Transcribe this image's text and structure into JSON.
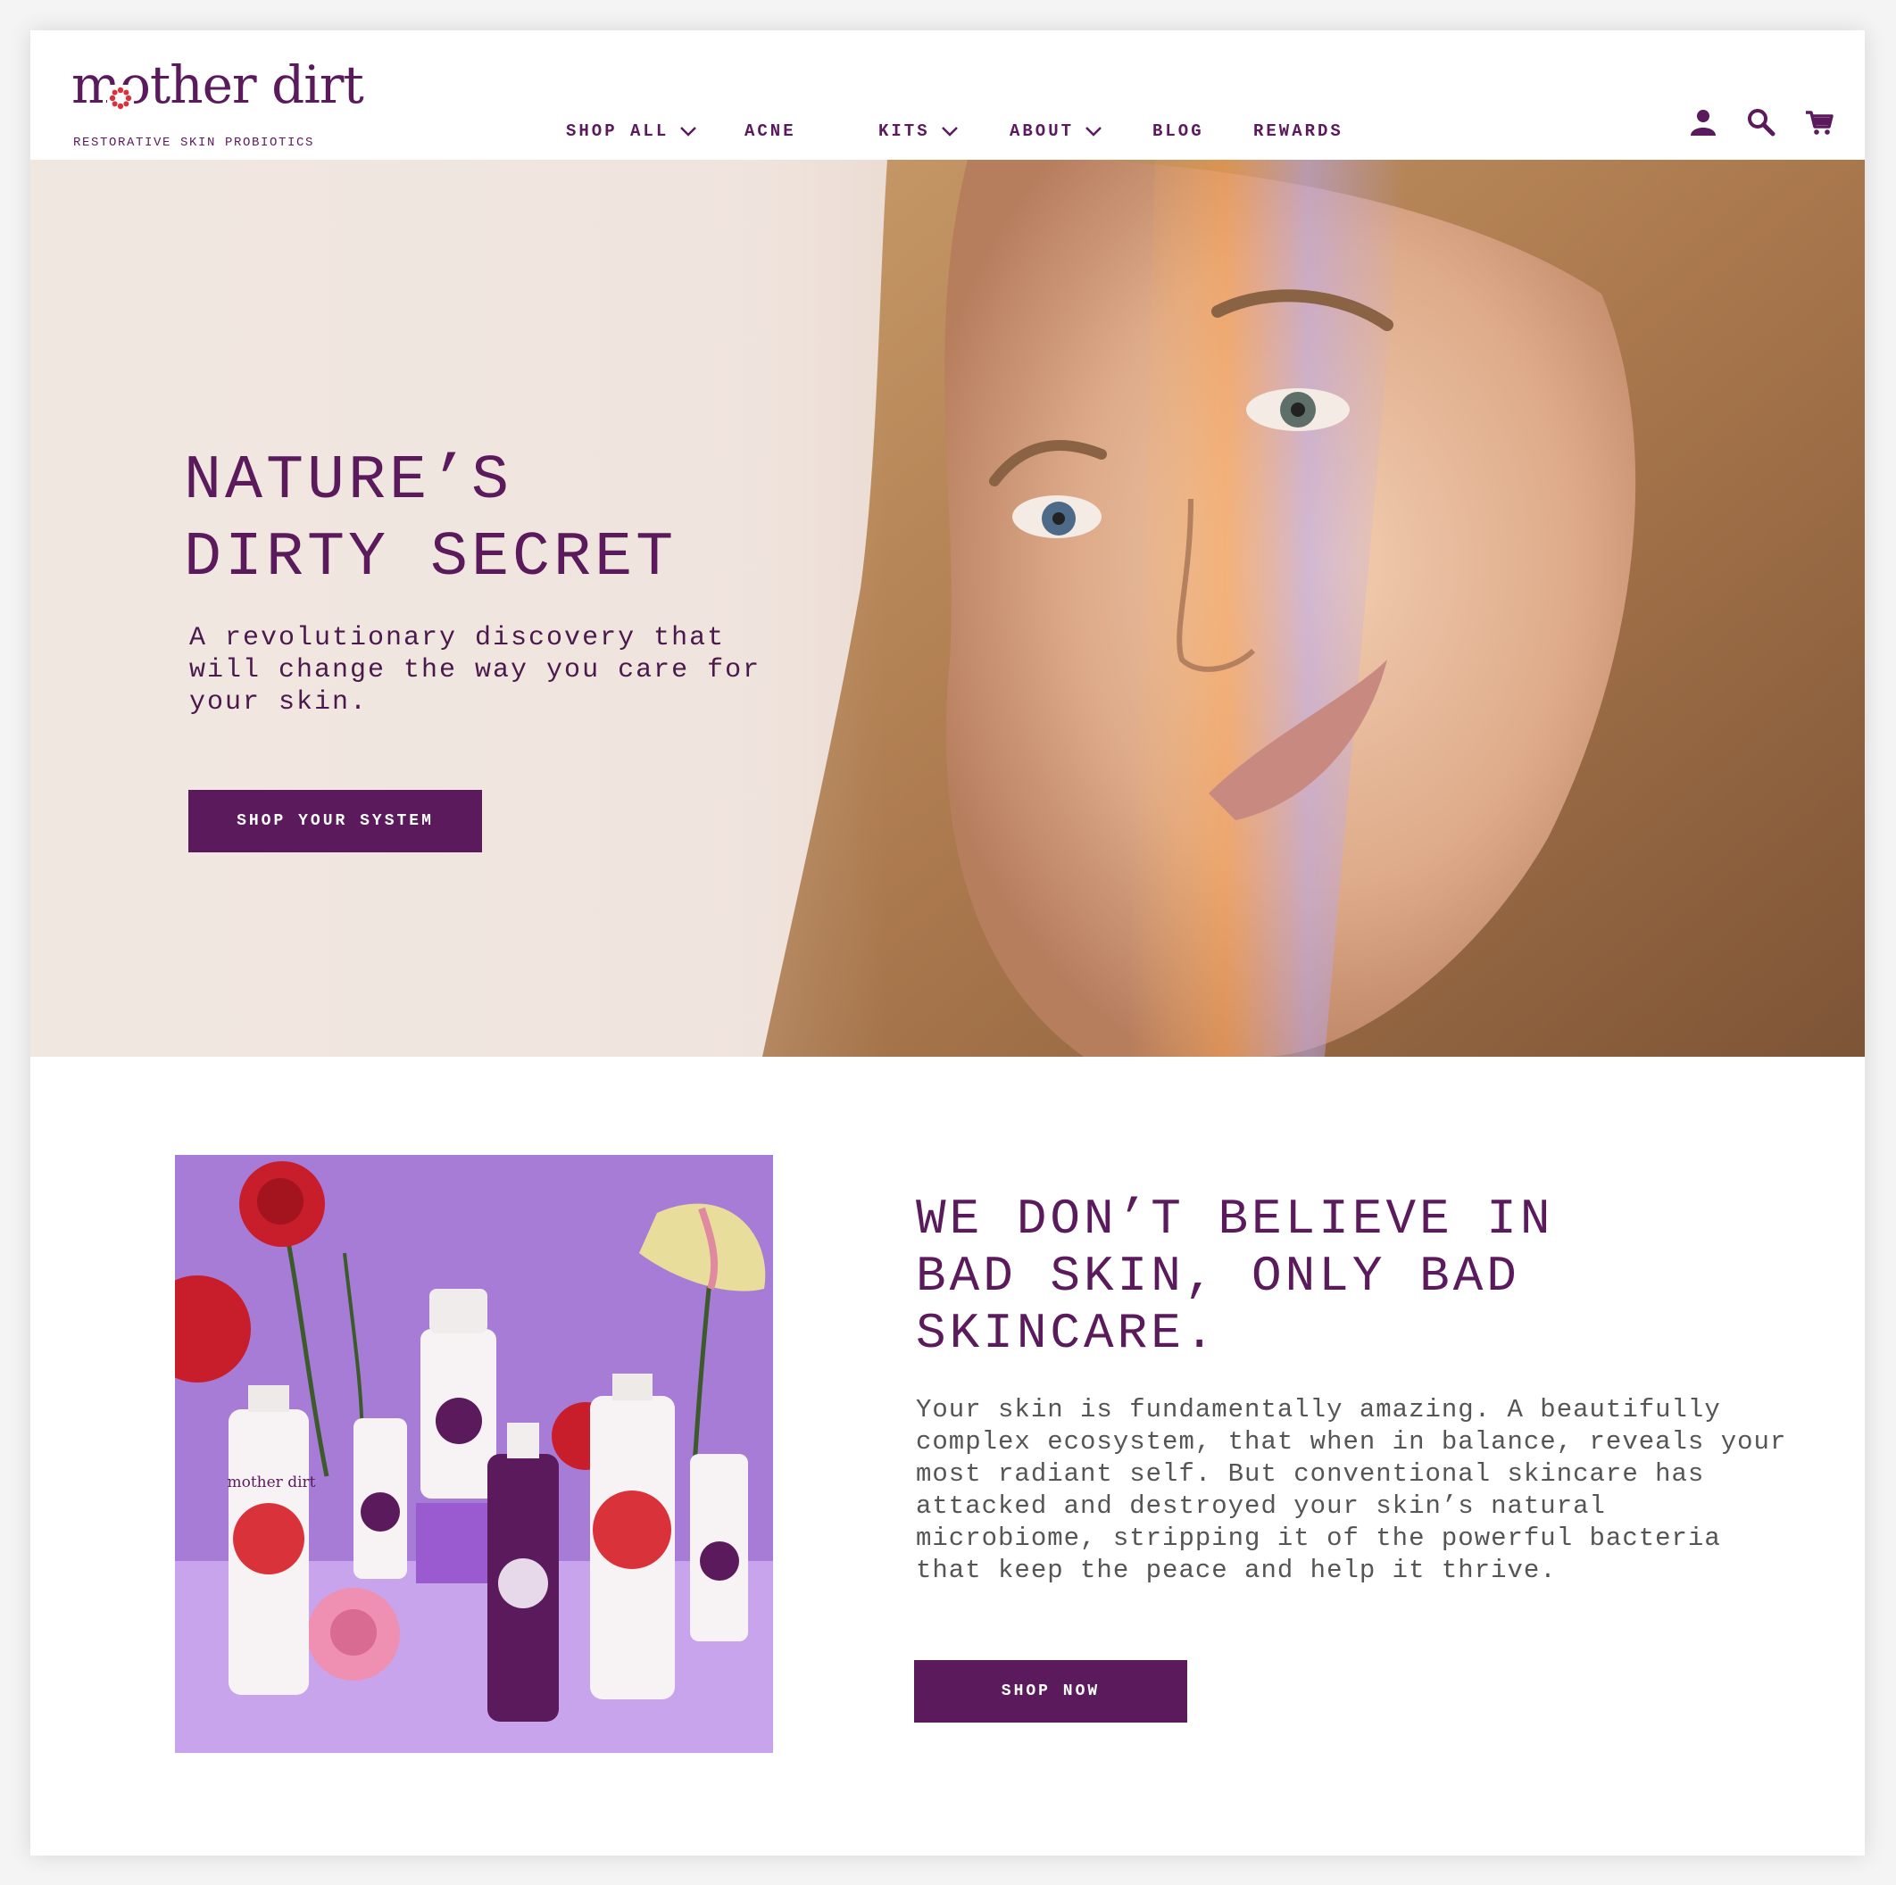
{
  "brand": {
    "name": "mother dirt",
    "tagline": "RESTORATIVE SKIN PROBIOTICS"
  },
  "nav": {
    "items": [
      {
        "label": "SHOP ALL",
        "has_dropdown": true
      },
      {
        "label": "ACNE",
        "has_dropdown": false
      },
      {
        "label": "KITS",
        "has_dropdown": true
      },
      {
        "label": "ABOUT",
        "has_dropdown": true
      },
      {
        "label": "BLOG",
        "has_dropdown": false
      },
      {
        "label": "REWARDS",
        "has_dropdown": false
      }
    ],
    "icons": [
      "account-icon",
      "search-icon",
      "cart-icon"
    ]
  },
  "hero": {
    "title": "NATURE’S\nDIRTY SECRET",
    "subtitle": "A revolutionary discovery that will change the way you care for your skin.",
    "cta": "SHOP YOUR SYSTEM"
  },
  "feature": {
    "title": "WE DON’T BELIEVE IN\nBAD SKIN, ONLY BAD\nSKINCARE.",
    "body": "Your skin is fundamentally amazing. A beautifully complex ecosystem, that when in balance, reveals your most radiant self. But conventional skincare has attacked and destroyed your skin’s natural microbiome, stripping it of the powerful bacteria that keep the peace and help it thrive.",
    "cta": "SHOP NOW",
    "product_label": "mother dirt"
  },
  "colors": {
    "brand_purple": "#5a1a5c",
    "accent_red": "#d9323a",
    "product_bg": "#a77bd6"
  }
}
